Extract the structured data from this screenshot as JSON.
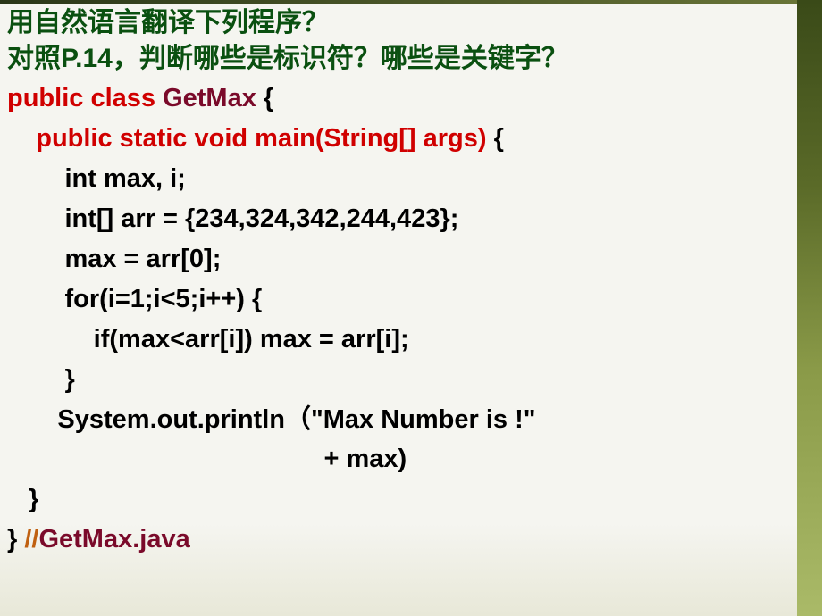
{
  "questions": {
    "q1": "用自然语言翻译下列程序？",
    "q2": "对照P.14，判断哪些是标识符？哪些是关键字？"
  },
  "code": {
    "l1_kw": "public class ",
    "l1_id": "GetMax ",
    "l1_br": "{",
    "l2_kw": "    public static void main(String[] args) ",
    "l2_br": "{",
    "l3": "        int max, i;",
    "l4": "        int[] arr = {234,324,342,244,423};",
    "l5": "        max = arr[0];",
    "l6": "        for(i=1;i<5;i++) {",
    "l7": "            if(max<arr[i]) max = arr[i];",
    "l8": "        }",
    "l9": "       System.out.println（\"Max Number is !\"",
    "l10": "                                            + max)",
    "l11": "   }",
    "l12_br": "} ",
    "l12_cm": "//",
    "l12_id": "GetMax.java"
  }
}
